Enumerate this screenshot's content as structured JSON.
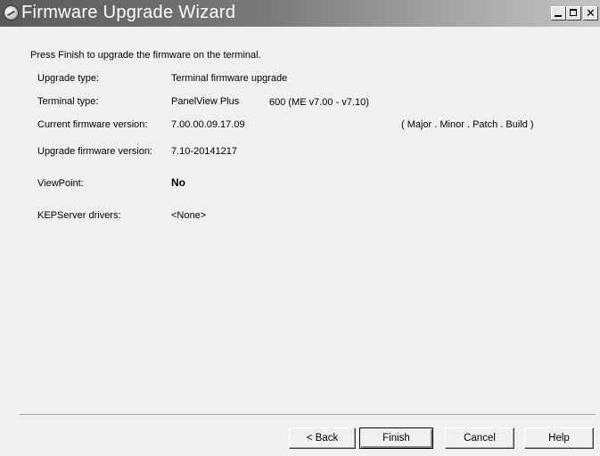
{
  "window": {
    "title": "Firmware Upgrade Wizard"
  },
  "content": {
    "intro": "Press Finish to upgrade the firmware on the terminal.",
    "fields": [
      {
        "label": "Upgrade type:",
        "value": "Terminal firmware upgrade"
      },
      {
        "label": "Terminal type:",
        "value": "PanelView Plus",
        "extra": "600 (ME v7.00 - v7.10)"
      },
      {
        "label": "Current firmware version:",
        "value": "7.00.00.09.17.09",
        "extra": "( Major . Minor . Patch . Build )"
      },
      {
        "label": "Upgrade firmware version:",
        "value": "7.10-20141217"
      },
      {
        "label": "ViewPoint:",
        "value": "No"
      },
      {
        "label": "KEPServer drivers:",
        "value": "<None>"
      }
    ]
  },
  "buttons": {
    "back": "< Back",
    "finish": "Finish",
    "cancel": "Cancel",
    "help": "Help"
  }
}
